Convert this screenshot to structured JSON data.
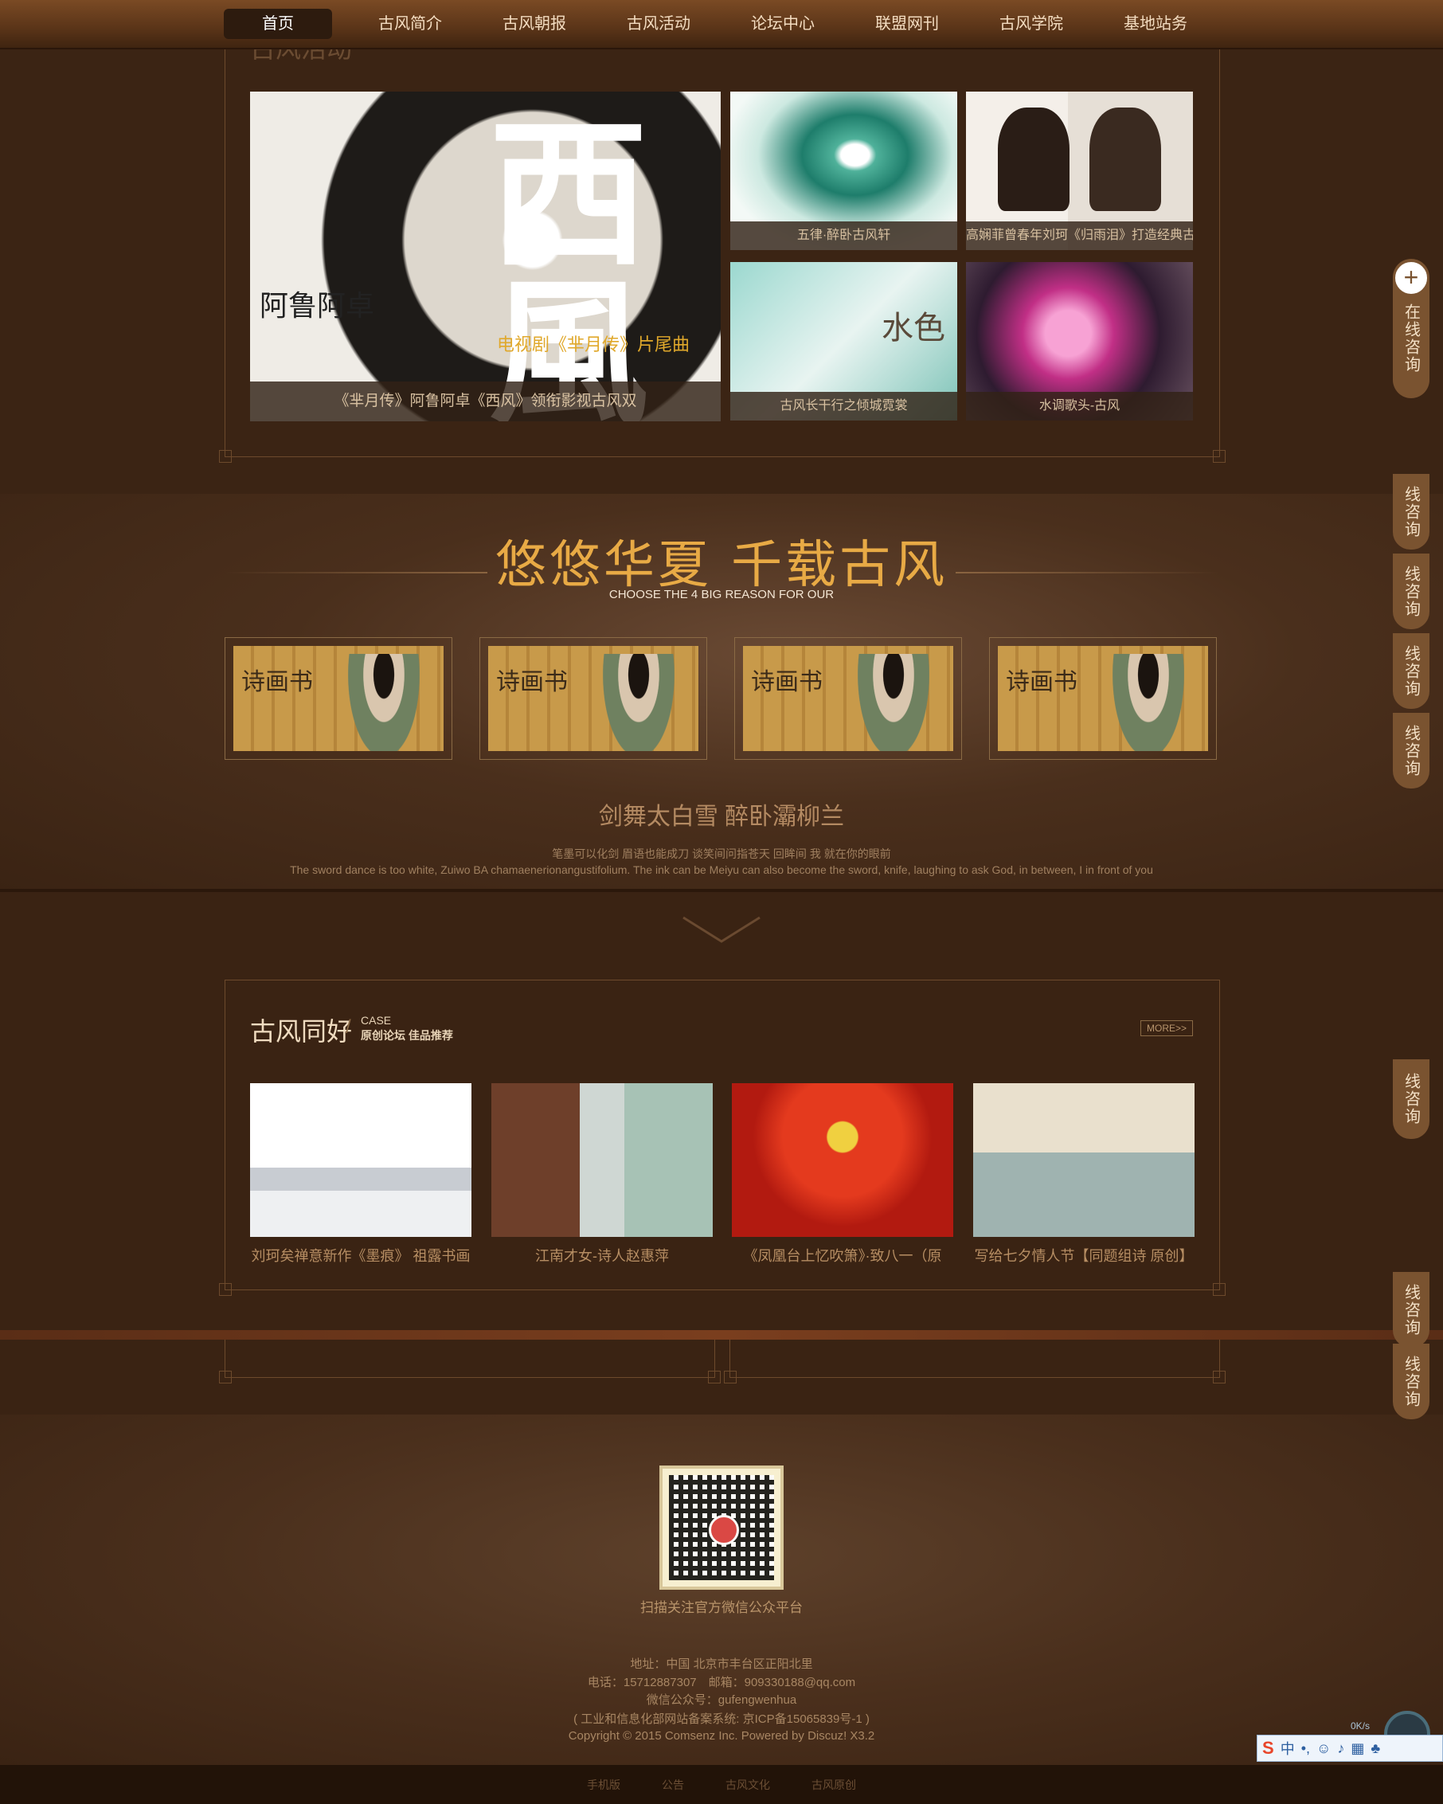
{
  "nav": {
    "items": [
      "首页",
      "古风简介",
      "古风朝报",
      "古风活动",
      "论坛中心",
      "联盟网刊",
      "古风学院",
      "基地站务"
    ],
    "active": "首页"
  },
  "activity": {
    "section_title": "古风活动",
    "tiles": [
      {
        "caption": "《芈月传》阿鲁阿卓《西风》领衔影视古风双",
        "art": "电视剧《芈月传》片尾曲"
      },
      {
        "caption": "五律·醉卧古风轩"
      },
      {
        "caption": "高娴菲曾春年刘珂《归雨泪》打造经典古"
      },
      {
        "caption": "古风长干行之倾城霓裳"
      },
      {
        "caption": "水调歌头-古风"
      }
    ]
  },
  "reason": {
    "title": "悠悠华夏 千载古风",
    "subtitle": "CHOOSE THE 4 BIG REASON FOR OUR",
    "cards": [
      {
        "text": "诗画书"
      },
      {
        "text": "诗画书"
      },
      {
        "text": "诗画书"
      },
      {
        "text": "诗画书"
      }
    ],
    "poem_title": "剑舞太白雪 醉卧灞柳兰",
    "poem_cn": "笔墨可以化剑 眉语也能成刀 谈笑间问指苍天 回眸间 我 就在你的眼前",
    "poem_en": "The sword dance is too white, Zuiwo BA chamaenerionangustifolium. The ink can be Meiyu can also become the sword, knife, laughing to ask God, in between, I in front of you"
  },
  "case": {
    "title": "古风同好",
    "en": "CASE",
    "sub": "原创论坛 佳品推荐",
    "more": "MORE>>",
    "items": [
      {
        "title": "刘珂矣禅意新作《墨痕》 祖露书画"
      },
      {
        "title": "江南才女-诗人赵惠萍"
      },
      {
        "title": "《凤凰台上忆吹箫》·致八一（原"
      },
      {
        "title": "写给七夕情人节【同题组诗 原创】"
      }
    ]
  },
  "side": {
    "main_label": "在线咨询",
    "tab_label": "线咨询"
  },
  "footer": {
    "qr_caption": "扫描关注官方微信公众平台",
    "address": "地址：中国 北京市丰台区正阳北里",
    "contact": "电话：15712887307　邮箱：909330188@qq.com",
    "wechat": "微信公众号：gufengwenhua",
    "icp": "( 工业和信息化部网站备案系统: 京ICP备15065839号-1 )",
    "copyright": "Copyright © 2015 Comsenz Inc. Powered by Discuz! X3.2",
    "links": [
      "手机版",
      "公告",
      "古风文化",
      "古风原创"
    ]
  },
  "ime": {
    "label": "中",
    "speed": "0K/s"
  }
}
